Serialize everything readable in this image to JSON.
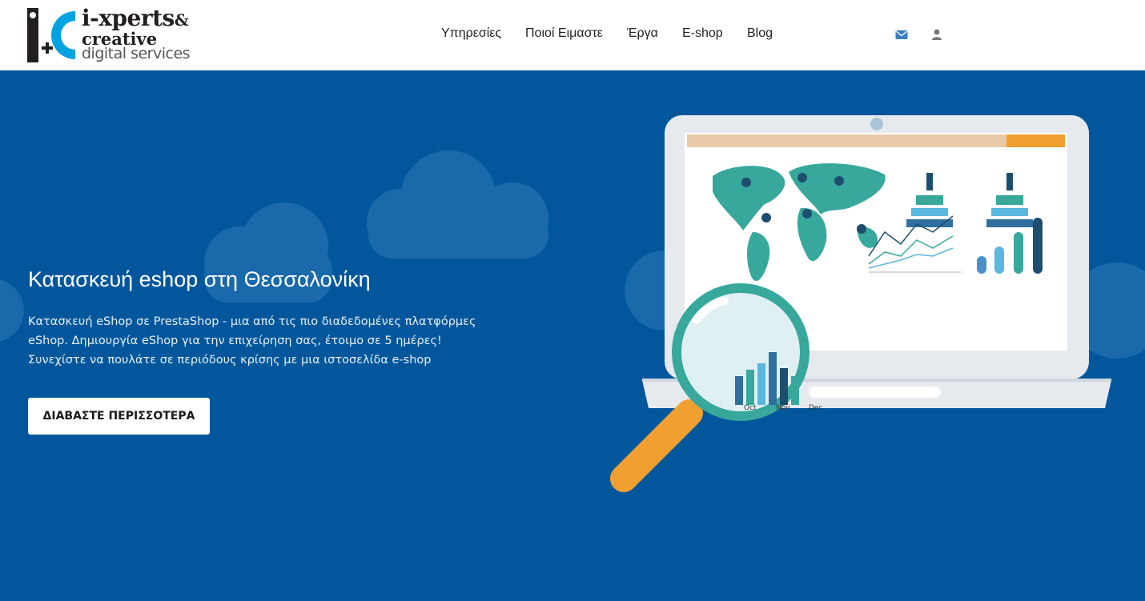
{
  "header": {
    "logo": {
      "line1": "i-xperts",
      "amp": "&",
      "line2": "creative",
      "line3": "digital services"
    },
    "nav": [
      {
        "label": "Υπηρεσίες"
      },
      {
        "label": "Ποιοί Ειμαστε"
      },
      {
        "label": "Έργα"
      },
      {
        "label": "E-shop"
      },
      {
        "label": "Blog"
      }
    ],
    "icons": [
      "envelope-icon",
      "user-icon"
    ]
  },
  "hero": {
    "title": "Κατασκευή eshop στη Θεσσαλονίκη",
    "description": "Κατασκευή eShop σε PrestaShop - μια από τις πιο διαδεδομένες πλατφόρμες eShop. Δημιουργία eShop για την επιχείρηση σας, έτοιμο σε 5 ημέρες! Συνεχίστε να πουλάτε σε περιόδους κρίσης με μια ιστοσελίδα e-shop",
    "button_label": "ΔΙΑΒΑΣΤΕ ΠΕΡΙΣΣΟΤΕΡΑ",
    "illustration": {
      "chart_labels": [
        "Oct",
        "Nov",
        "Dec"
      ]
    }
  },
  "colors": {
    "hero_bg": "#02579c",
    "accent_orange": "#f0a030",
    "teal": "#38a89d",
    "icon_blue": "#3a7fc1"
  }
}
